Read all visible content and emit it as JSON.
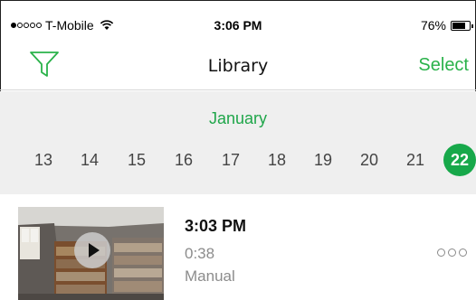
{
  "status_bar": {
    "carrier": "T-Mobile",
    "time": "3:06 PM",
    "battery": "76%",
    "battery_level": 0.76,
    "signal_bars": 1,
    "icons": [
      "signal-dots-icon",
      "wifi-icon",
      "battery-icon"
    ]
  },
  "nav": {
    "title": "Library",
    "select_label": "Select",
    "filter_icon": "filter-funnel-icon",
    "accent_color": "#2ab24a"
  },
  "date_strip": {
    "month": "January",
    "days": [
      "13",
      "14",
      "15",
      "16",
      "17",
      "18",
      "19",
      "20",
      "21",
      "22"
    ],
    "selected_day": "22",
    "selected_color": "#17a84a"
  },
  "recordings": [
    {
      "time": "3:03 PM",
      "duration": "0:38",
      "mode": "Manual",
      "thumbnail_icon": "play-icon",
      "more_icon": "more-options-icon"
    }
  ]
}
